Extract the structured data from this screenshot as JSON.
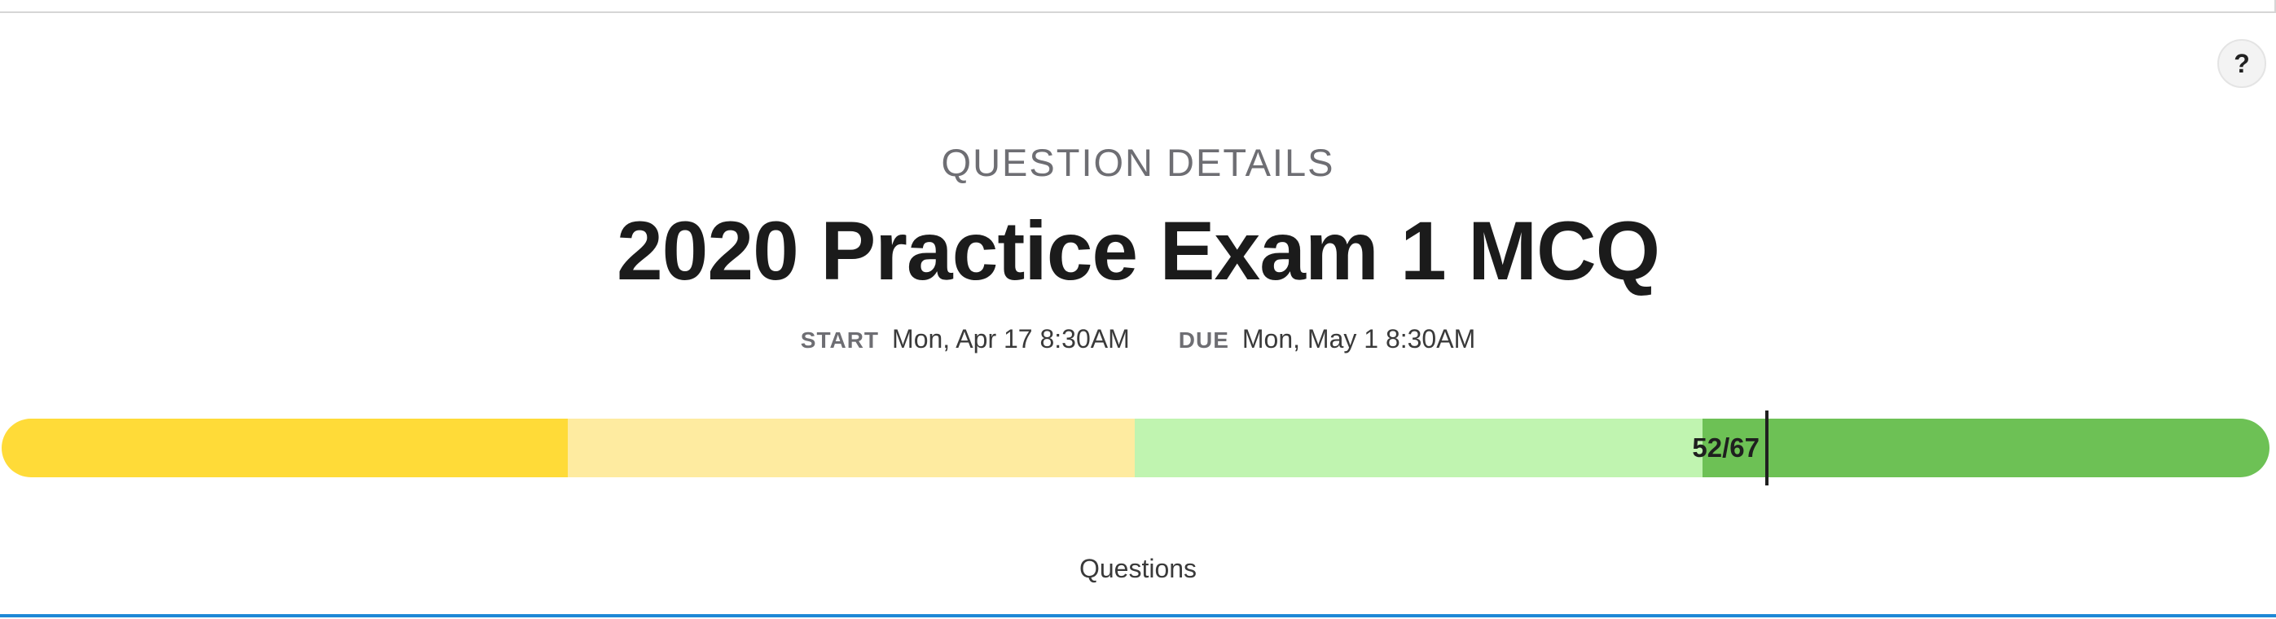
{
  "header": {
    "help_label": "?"
  },
  "main": {
    "section_label": "QUESTION DETAILS",
    "title": "2020 Practice Exam 1 MCQ",
    "start_label": "START",
    "start_value": "Mon, Apr 17 8:30AM",
    "due_label": "DUE",
    "due_value": "Mon, May 1 8:30AM"
  },
  "progress": {
    "completed": 52,
    "total": 67,
    "label": "52/67",
    "colors": [
      "#ffdb38",
      "#feeba0",
      "#c0f4b0",
      "#6dc155"
    ]
  },
  "tabs": {
    "questions_label": "Questions",
    "active_color": "#1e88d6"
  }
}
